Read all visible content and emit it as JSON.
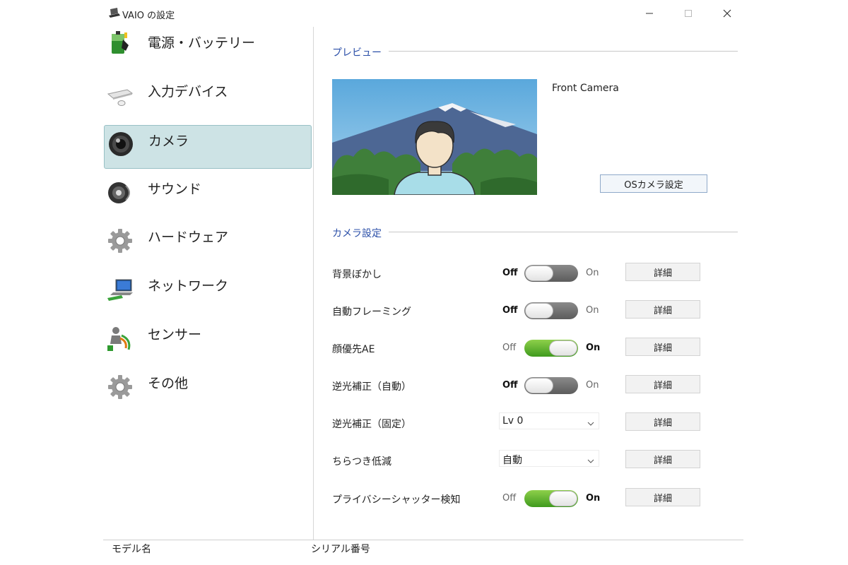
{
  "window": {
    "title": "VAIO の設定",
    "minimize_icon": "minimize-icon",
    "maximize_icon": "maximize-icon",
    "close_icon": "close-icon"
  },
  "sidebar": {
    "items": [
      {
        "label": "電源・バッテリー",
        "icon": "battery-icon"
      },
      {
        "label": "入力デバイス",
        "icon": "keyboard-mouse-icon"
      },
      {
        "label": "カメラ",
        "icon": "camera-lens-icon",
        "selected": true
      },
      {
        "label": "サウンド",
        "icon": "speaker-icon"
      },
      {
        "label": "ハードウェア",
        "icon": "gear-icon"
      },
      {
        "label": "ネットワーク",
        "icon": "network-laptop-icon"
      },
      {
        "label": "センサー",
        "icon": "sensor-person-icon"
      },
      {
        "label": "その他",
        "icon": "gear-icon"
      }
    ]
  },
  "main": {
    "preview_section": {
      "title": "プレビュー",
      "camera_name": "Front Camera",
      "os_camera_button": "OSカメラ設定"
    },
    "camera_section": {
      "title": "カメラ設定",
      "detail_label": "詳細",
      "rows": [
        {
          "label": "背景ぼかし",
          "control": "toggle",
          "state": "off",
          "off_label": "Off",
          "on_label": "On"
        },
        {
          "label": "自動フレーミング",
          "control": "toggle",
          "state": "off",
          "off_label": "Off",
          "on_label": "On"
        },
        {
          "label": "顔優先AE",
          "control": "toggle",
          "state": "on",
          "off_label": "Off",
          "on_label": "On"
        },
        {
          "label": "逆光補正（自動）",
          "control": "toggle",
          "state": "off",
          "off_label": "Off",
          "on_label": "On"
        },
        {
          "label": "逆光補正（固定）",
          "control": "select",
          "value": "Lv 0"
        },
        {
          "label": "ちらつき低減",
          "control": "select",
          "value": "自動"
        },
        {
          "label": "プライバシーシャッター検知",
          "control": "toggle",
          "state": "on",
          "off_label": "Off",
          "on_label": "On"
        }
      ]
    }
  },
  "footer": {
    "model_label": "モデル名",
    "serial_label": "シリアル番号"
  },
  "colors": {
    "section_title": "#2b4fa8",
    "selected_nav_bg": "#cde3e5",
    "toggle_on": "#5cb82e",
    "toggle_off": "#6e6e6e"
  }
}
